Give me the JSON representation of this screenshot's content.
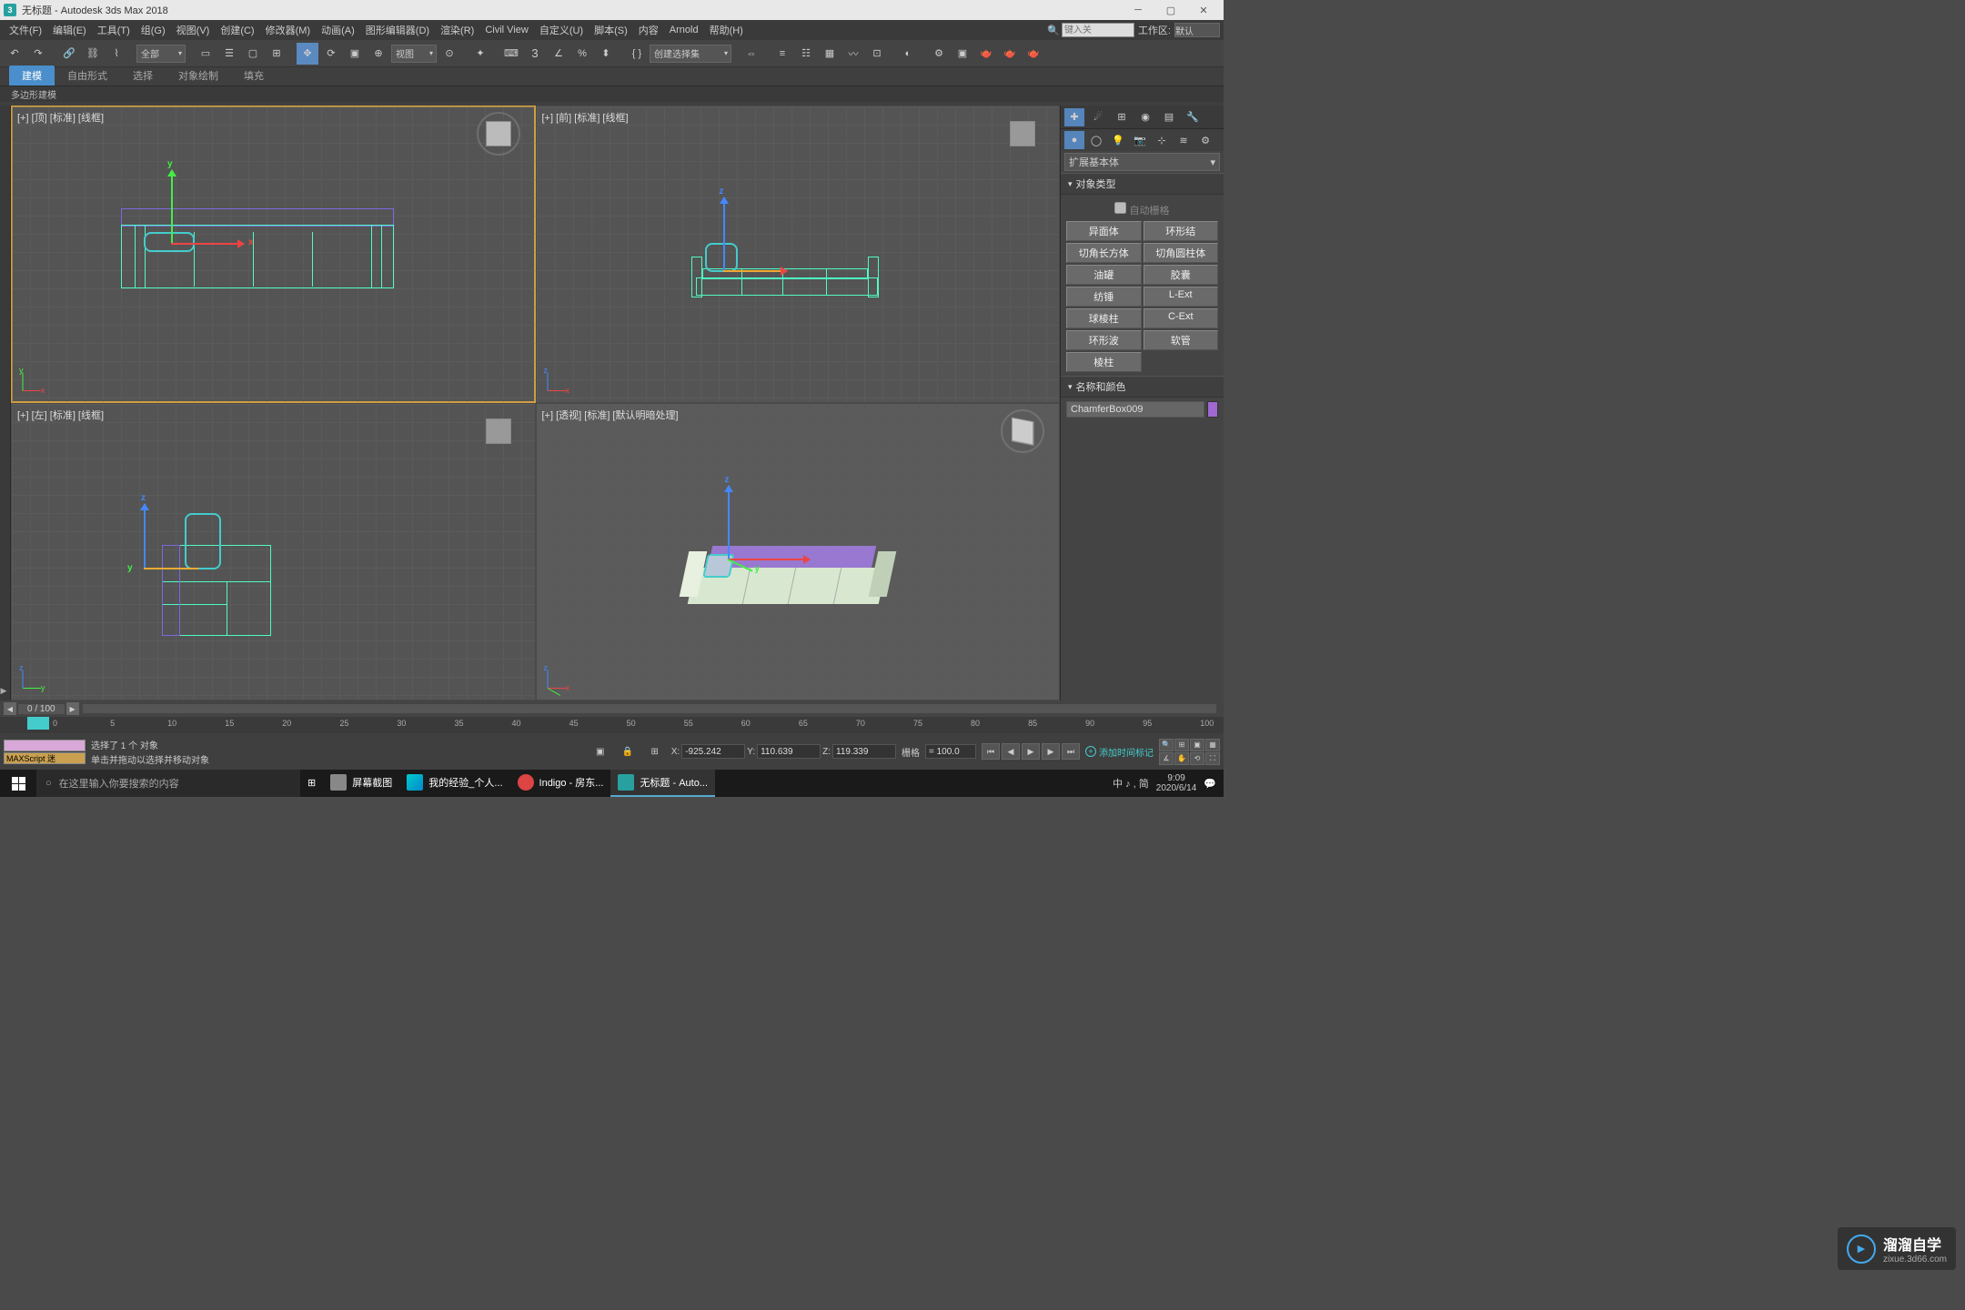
{
  "title": "无标题 - Autodesk 3ds Max 2018",
  "menus": [
    "文件(F)",
    "编辑(E)",
    "工具(T)",
    "组(G)",
    "视图(V)",
    "创建(C)",
    "修改器(M)",
    "动画(A)",
    "图形编辑器(D)",
    "渲染(R)",
    "Civil View",
    "自定义(U)",
    "脚本(S)",
    "内容",
    "Arnold",
    "帮助(H)"
  ],
  "search_placeholder": "键入关",
  "workspace_label": "工作区:",
  "workspace_value": "默认",
  "toolbar": {
    "group_dropdown": "全部",
    "view_dropdown": "视图",
    "selset_dropdown": "创建选择集"
  },
  "ribbon": {
    "tabs": [
      "建模",
      "自由形式",
      "选择",
      "对象绘制",
      "填充"
    ],
    "sub": "多边形建模"
  },
  "viewports": {
    "tl": "[+] [顶] [标准] [线框]",
    "tr": "[+] [前] [标准] [线框]",
    "bl": "[+] [左] [标准] [线框]",
    "br": "[+] [透视] [标准] [默认明暗处理]"
  },
  "command_panel": {
    "category": "扩展基本体",
    "rollout1": "对象类型",
    "autogrid": "自动栅格",
    "buttons": [
      "异面体",
      "环形结",
      "切角长方体",
      "切角圆柱体",
      "油罐",
      "胶囊",
      "纺锤",
      "L-Ext",
      "球棱柱",
      "C-Ext",
      "环形波",
      "软管",
      "棱柱"
    ],
    "rollout2": "名称和颜色",
    "object_name": "ChamferBox009"
  },
  "timeline": {
    "frame": "0  /  100",
    "ticks": [
      "0",
      "5",
      "10",
      "15",
      "20",
      "25",
      "30",
      "35",
      "40",
      "45",
      "50",
      "55",
      "60",
      "65",
      "70",
      "75",
      "80",
      "85",
      "90",
      "95",
      "100"
    ]
  },
  "status": {
    "maxscript": "MAXScript 迷",
    "msg1": "选择了 1 个 对象",
    "msg2": "单击并拖动以选择并移动对象",
    "x": "-925.242",
    "y": "110.639",
    "z": "119.339",
    "grid_label": "栅格",
    "grid_val": "= 100.0",
    "add_time": "添加时间标记"
  },
  "taskbar": {
    "search": "在这里输入你要搜索的内容",
    "items": [
      "屏幕截图",
      "我的经验_个人...",
      "Indigo - 房东...",
      "无标题 - Auto..."
    ],
    "ime": "中 ♪ , 简",
    "time": "9:09",
    "date": "2020/6/14"
  },
  "watermark": {
    "name": "溜溜自学",
    "url": "zixue.3d66.com"
  }
}
